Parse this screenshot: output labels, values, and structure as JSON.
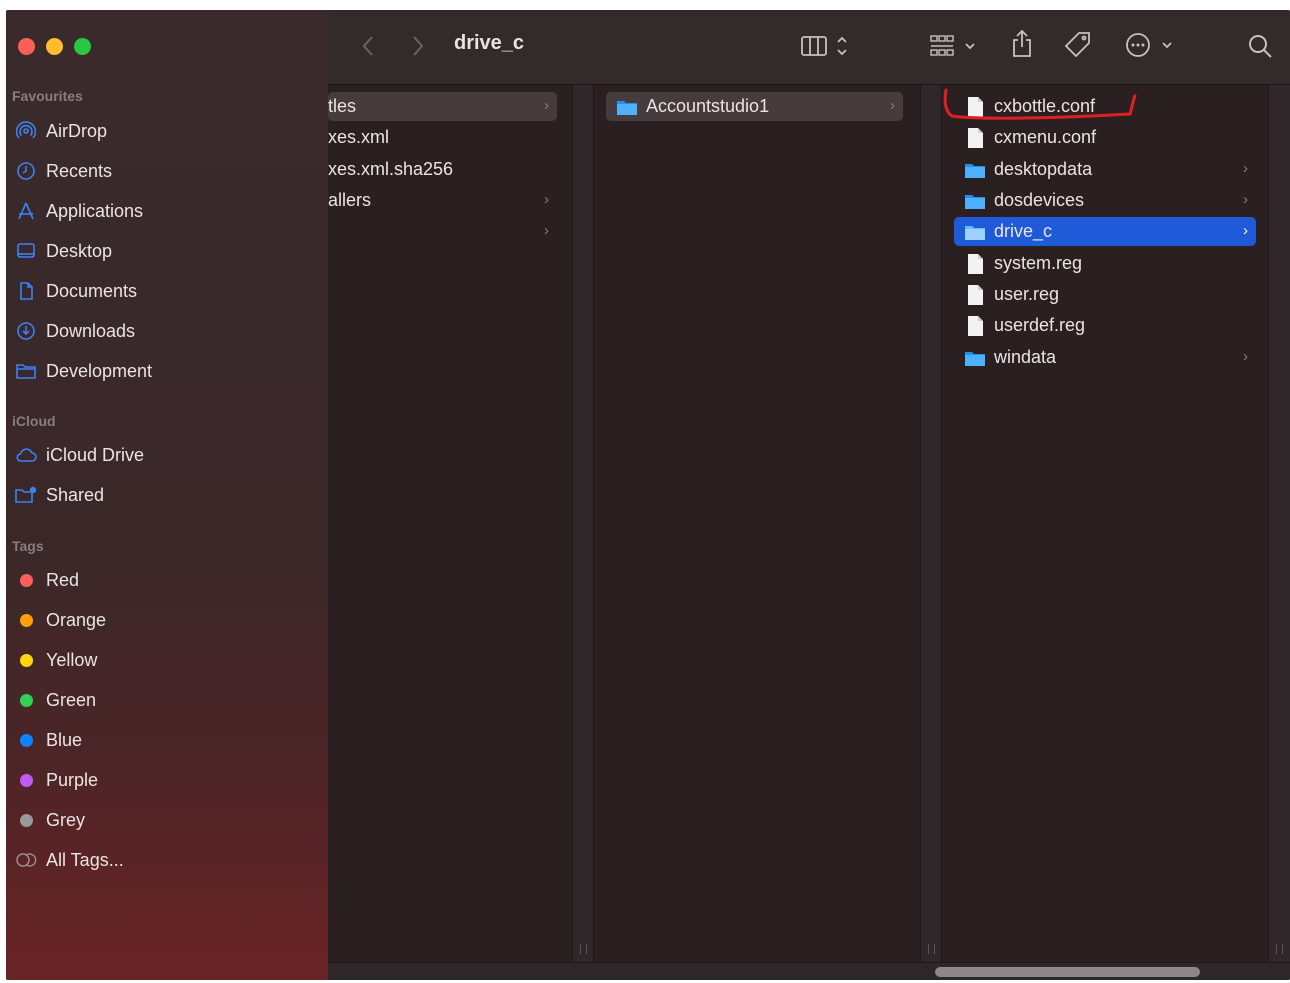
{
  "window": {
    "title": "drive_c",
    "traffic_lights": [
      "#ff5f57",
      "#febc2e",
      "#28c840"
    ]
  },
  "toolbar": {
    "back_icon": "chevron-left-icon",
    "forward_icon": "chevron-right-icon",
    "view_icon": "columns-view-icon",
    "group_icon": "grid-group-icon",
    "share_icon": "share-icon",
    "tag_icon": "tag-icon",
    "more_icon": "ellipsis-circle-icon",
    "search_icon": "search-icon"
  },
  "sidebar": {
    "favourites_title": "Favourites",
    "favourites": [
      {
        "label": "AirDrop",
        "icon": "airdrop-icon"
      },
      {
        "label": "Recents",
        "icon": "clock-icon"
      },
      {
        "label": "Applications",
        "icon": "applications-icon"
      },
      {
        "label": "Desktop",
        "icon": "desktop-icon"
      },
      {
        "label": "Documents",
        "icon": "document-icon"
      },
      {
        "label": "Downloads",
        "icon": "download-icon"
      },
      {
        "label": "Development",
        "icon": "folder-icon"
      }
    ],
    "icloud_title": "iCloud",
    "icloud": [
      {
        "label": "iCloud Drive",
        "icon": "cloud-icon"
      },
      {
        "label": "Shared",
        "icon": "shared-folder-icon"
      }
    ],
    "tags_title": "Tags",
    "tags": [
      {
        "label": "Red",
        "color": "#ff5f57"
      },
      {
        "label": "Orange",
        "color": "#ff9f0a"
      },
      {
        "label": "Yellow",
        "color": "#ffd60a"
      },
      {
        "label": "Green",
        "color": "#30d158"
      },
      {
        "label": "Blue",
        "color": "#0a84ff"
      },
      {
        "label": "Purple",
        "color": "#bf5af2"
      },
      {
        "label": "Grey",
        "color": "#98989d"
      }
    ],
    "all_tags": "All Tags..."
  },
  "columns": {
    "col1": [
      "tles",
      "xes.xml",
      "xes.xml.sha256",
      "allers",
      ""
    ],
    "col2": [
      "Accountstudio1"
    ],
    "col3": [
      {
        "name": "cxbottle.conf",
        "type": "file"
      },
      {
        "name": "cxmenu.conf",
        "type": "file"
      },
      {
        "name": "desktopdata",
        "type": "folder"
      },
      {
        "name": "dosdevices",
        "type": "folder"
      },
      {
        "name": "drive_c",
        "type": "folder",
        "selected": true
      },
      {
        "name": "system.reg",
        "type": "file"
      },
      {
        "name": "user.reg",
        "type": "file"
      },
      {
        "name": "userdef.reg",
        "type": "file"
      },
      {
        "name": "windata",
        "type": "folder"
      }
    ]
  },
  "accent": "#1f5ad8",
  "annotation_color": "#e02020"
}
